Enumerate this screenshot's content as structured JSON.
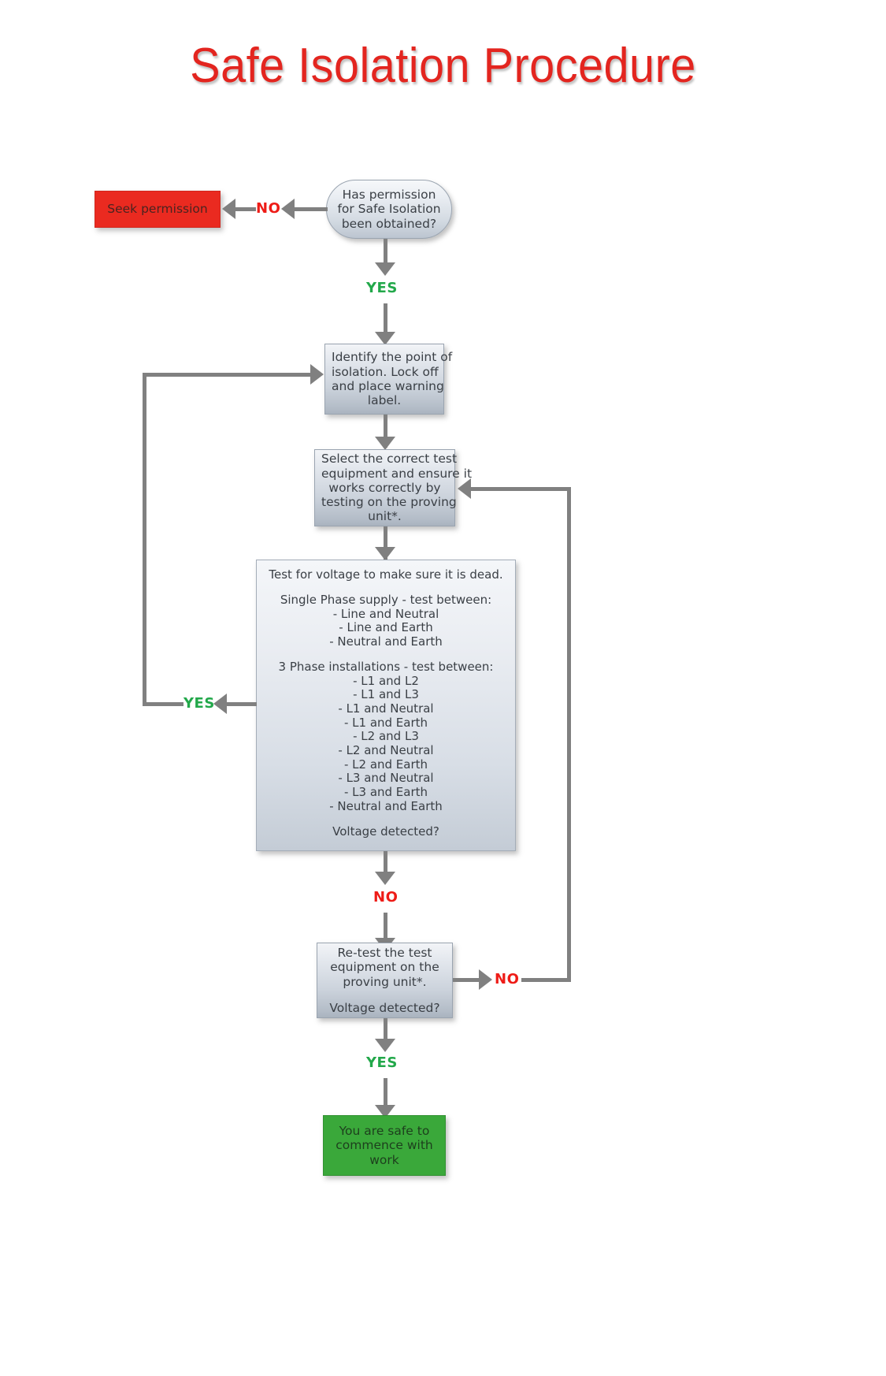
{
  "title": "Safe Isolation Procedure",
  "nodes": {
    "seek_permission": "Seek permission",
    "permission_check": {
      "line1": "Has permission",
      "line2": "for Safe Isolation",
      "line3": "been obtained?"
    },
    "identify": {
      "line1": "Identify the point of",
      "line2": "isolation. Lock off",
      "line3": "and place warning",
      "line4": "label."
    },
    "select_equipment": {
      "line1": "Select the correct test",
      "line2": "equipment and ensure it",
      "line3": "works correctly by",
      "line4": "testing on the proving",
      "line5": "unit*."
    },
    "voltage_test": {
      "heading": "Test for voltage to make sure it is dead.",
      "single_phase_title": "Single Phase supply - test between:",
      "single_phase_items": [
        "- Line and Neutral",
        "- Line and Earth",
        "- Neutral and Earth"
      ],
      "three_phase_title": "3 Phase installations - test between:",
      "three_phase_items": [
        "- L1 and L2",
        "- L1 and L3",
        "- L1 and Neutral",
        "- L1 and Earth",
        "- L2 and L3",
        "- L2 and Neutral",
        "- L2 and Earth",
        "- L3 and Neutral",
        "- L3 and Earth",
        "- Neutral and Earth"
      ],
      "question": "Voltage detected?"
    },
    "retest": {
      "line1": "Re-test the test",
      "line2": "equipment on the",
      "line3": "proving unit*.",
      "question": "Voltage detected?"
    },
    "safe": {
      "line1": "You are safe to",
      "line2": "commence with",
      "line3": "work"
    }
  },
  "edge_labels": {
    "permission_no": "NO",
    "permission_yes": "YES",
    "voltage_yes": "YES",
    "voltage_no": "NO",
    "retest_no": "NO",
    "retest_yes": "YES"
  },
  "colors": {
    "title": "#e3251f",
    "no": "#ee1c17",
    "yes": "#22a84a",
    "connector": "#808080",
    "terminal_red": "#ea2a20",
    "terminal_green": "#3aa83a"
  }
}
